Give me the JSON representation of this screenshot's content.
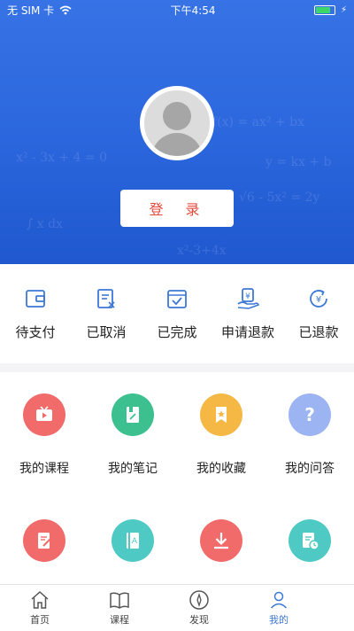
{
  "status_bar": {
    "carrier": "无 SIM 卡",
    "time": "下午4:54",
    "battery_level": 0.8
  },
  "header": {
    "login_label": "登 录",
    "math_texts": [
      "√6 - 5x² = 2y",
      "x² - 3x + 4 = 0",
      "f(x) = ax² + bx",
      "∫ x dx",
      "y = kx + b",
      "x²-3+4x"
    ]
  },
  "orders": [
    {
      "label": "待支付",
      "icon": "wallet-icon"
    },
    {
      "label": "已取消",
      "icon": "cancelled-list-icon"
    },
    {
      "label": "已完成",
      "icon": "completed-calendar-icon"
    },
    {
      "label": "申请退款",
      "icon": "refund-request-icon"
    },
    {
      "label": "已退款",
      "icon": "refunded-icon"
    }
  ],
  "features": [
    {
      "label": "我的课程",
      "icon": "video-icon",
      "color": "#f26b6b"
    },
    {
      "label": "我的笔记",
      "icon": "note-icon",
      "color": "#3cc08f"
    },
    {
      "label": "我的收藏",
      "icon": "bookmark-star-icon",
      "color": "#f5b845"
    },
    {
      "label": "我的问答",
      "icon": "question-icon",
      "color": "#9cb4f1"
    },
    {
      "label": "",
      "icon": "edit-document-icon",
      "color": "#f26b6b"
    },
    {
      "label": "",
      "icon": "book-icon",
      "color": "#4ec9c3"
    },
    {
      "label": "",
      "icon": "download-icon",
      "color": "#f26b6b"
    },
    {
      "label": "",
      "icon": "clock-document-icon",
      "color": "#4ec9c3"
    }
  ],
  "tabs": [
    {
      "label": "首页",
      "icon": "home-icon"
    },
    {
      "label": "课程",
      "icon": "book-open-icon"
    },
    {
      "label": "发现",
      "icon": "compass-icon"
    },
    {
      "label": "我的",
      "icon": "user-icon"
    }
  ],
  "colors": {
    "header_blue": "#2c67de",
    "order_icon_blue": "#3d78d6",
    "login_text_red": "#e74a3e"
  }
}
